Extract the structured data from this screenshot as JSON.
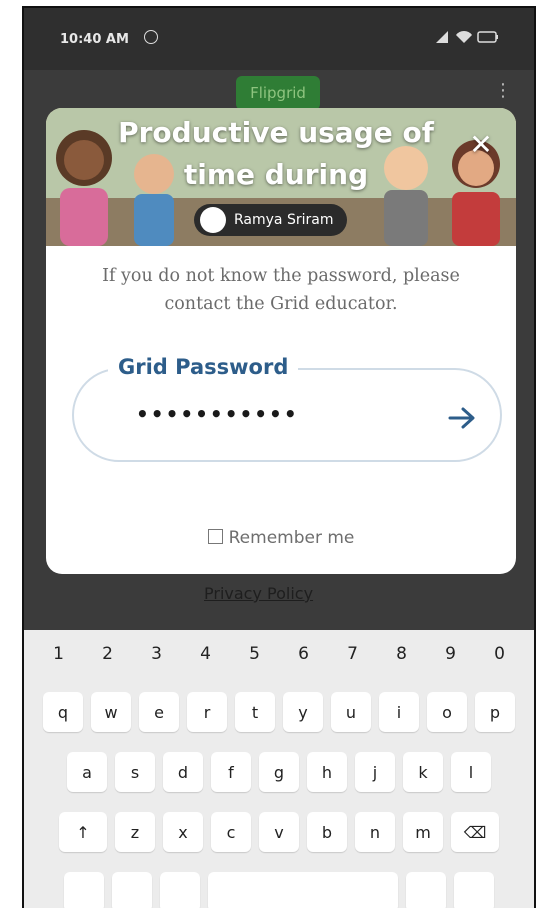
{
  "status_bar": {
    "time": "10:40 AM"
  },
  "background": {
    "logo_text": "Flipgrid"
  },
  "dialog": {
    "title": "Productive usage of time during",
    "close_label": "✕",
    "user_name": "Ramya Sriram",
    "hint": "If you do not know the password, please contact the Grid educator.",
    "password_label": "Grid Password",
    "password_value": "•••••••••••",
    "submit_icon": "→",
    "remember_label": "Remember me"
  },
  "privacy_link": "Privacy Policy",
  "keyboard": {
    "numbers": [
      "1",
      "2",
      "3",
      "4",
      "5",
      "6",
      "7",
      "8",
      "9",
      "0"
    ],
    "row1": [
      "q",
      "w",
      "e",
      "r",
      "t",
      "y",
      "u",
      "i",
      "o",
      "p"
    ],
    "row2": [
      "a",
      "s",
      "d",
      "f",
      "g",
      "h",
      "j",
      "k",
      "l"
    ],
    "row3": [
      "↑",
      "z",
      "x",
      "c",
      "v",
      "b",
      "n",
      "m",
      "⌫"
    ]
  },
  "icons": {
    "status": [
      "clock-icon",
      "signal-icon",
      "wifi-icon",
      "battery-icon"
    ],
    "dialog": [
      "close-icon",
      "arrow-right-icon",
      "checkbox-icon"
    ],
    "keyboard": [
      "shift-icon",
      "backspace-icon"
    ]
  }
}
